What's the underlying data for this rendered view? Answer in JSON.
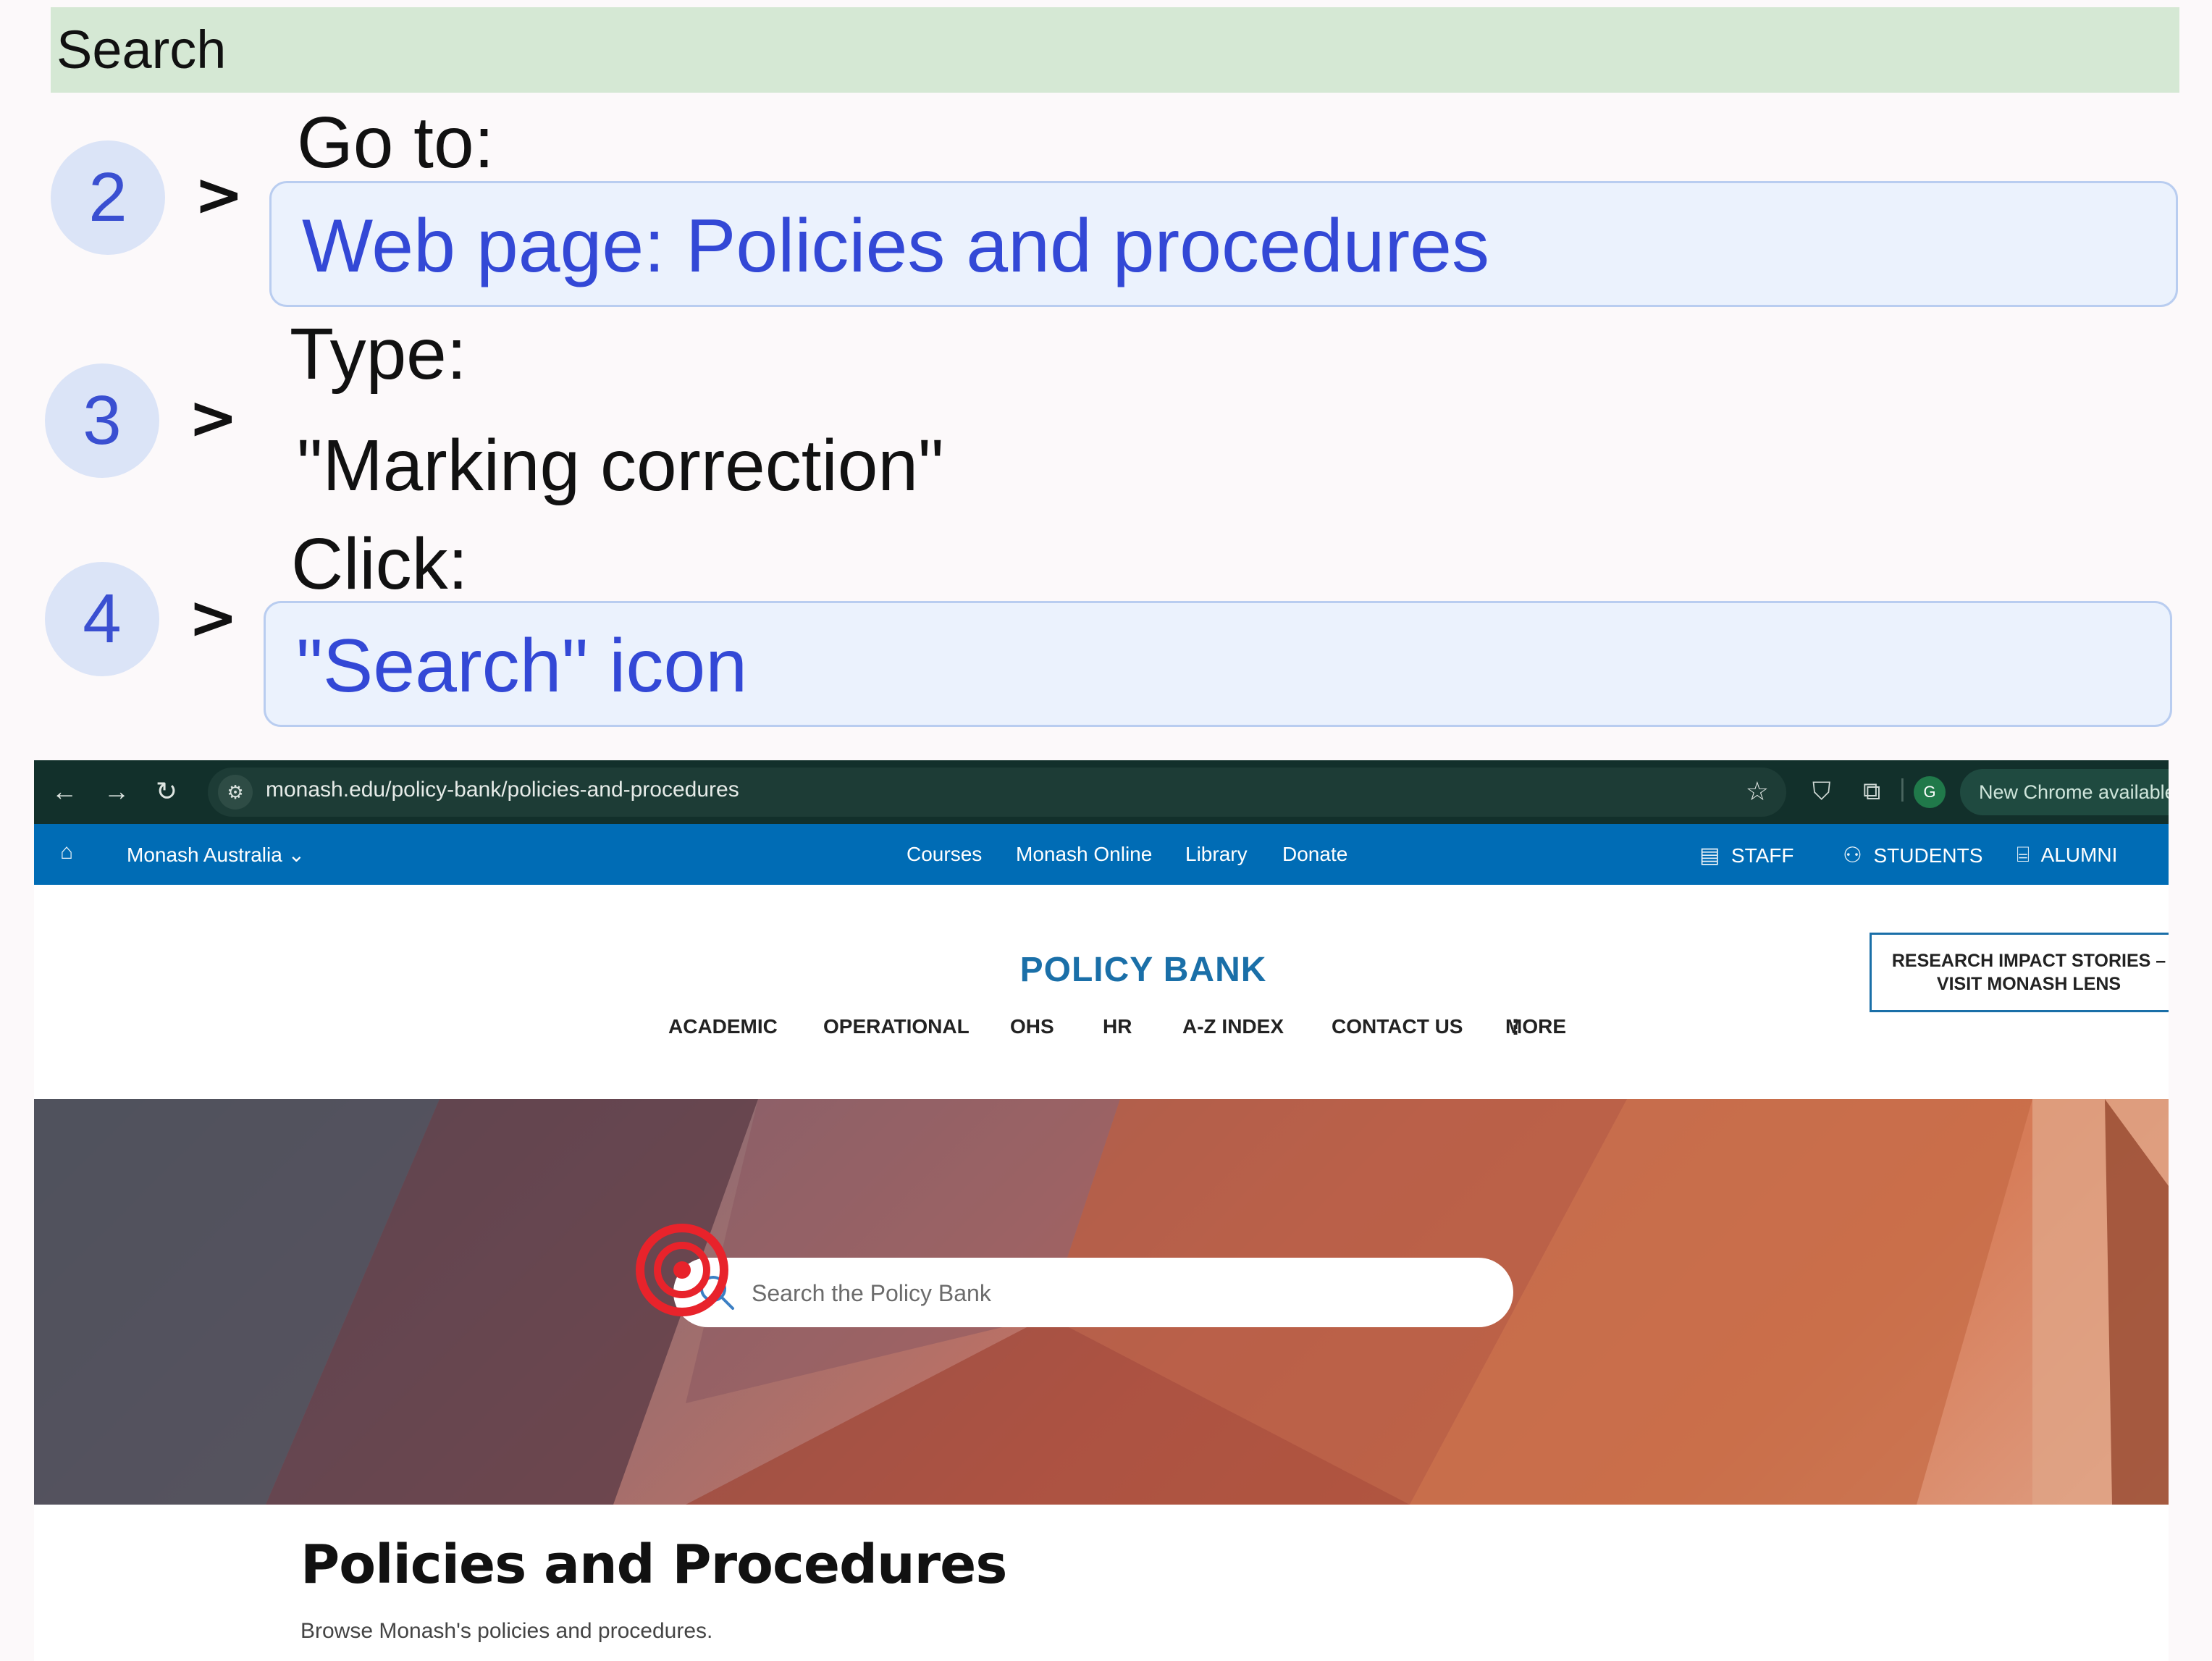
{
  "header": {
    "title": "Search"
  },
  "steps": [
    {
      "number": "2",
      "label": "Go to:",
      "value": "Web page: Policies and procedures"
    },
    {
      "number": "3",
      "label": "Type:",
      "value": "\"Marking correction\""
    },
    {
      "number": "4",
      "label": "Click:",
      "value": "\"Search\" icon"
    }
  ],
  "browser": {
    "url": "monash.edu/policy-bank/policies-and-procedures",
    "profile_initial": "G",
    "update_text": "New Chrome available"
  },
  "topbar": {
    "site_selector": "Monash Australia",
    "links": [
      "Courses",
      "Monash Online",
      "Library",
      "Donate"
    ],
    "audience": [
      "STAFF",
      "STUDENTS",
      "ALUMNI"
    ]
  },
  "site": {
    "title": "POLICY BANK",
    "nav": [
      "ACADEMIC",
      "OPERATIONAL",
      "OHS",
      "HR",
      "A-Z INDEX",
      "CONTACT US",
      "MORE"
    ],
    "research_line1": "RESEARCH IMPACT STORIES –",
    "research_line2": "VISIT MONASH LENS"
  },
  "search": {
    "placeholder": "Search the Policy Bank"
  },
  "page": {
    "heading": "Policies and Procedures",
    "subtext": "Browse Monash's policies and procedures."
  },
  "colors": {
    "accent_blue": "#006cb5",
    "target_red": "#e8232b"
  }
}
